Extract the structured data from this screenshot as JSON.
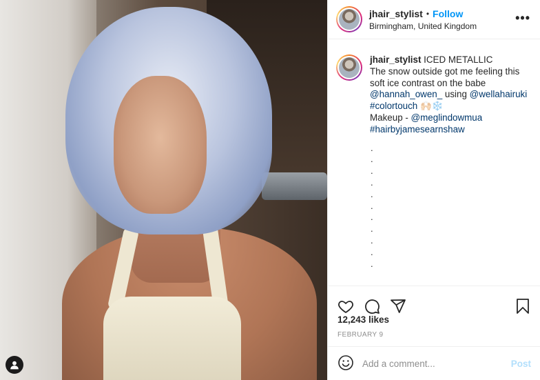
{
  "post": {
    "author": "jhair_stylist",
    "follow_separator": "•",
    "follow_label": "Follow",
    "location": "Birmingham, United Kingdom",
    "more_label": "•••"
  },
  "caption": {
    "author": "jhair_stylist",
    "line1_text": " ICED METALLIC",
    "line2": "The snow outside got me feeling this soft ice contrast on the babe",
    "mention_hannah": "@hannah_owen_",
    "using_text": " using ",
    "mention_wella": "@wellahairuki",
    "hashtag_colortouch": "#colortouch",
    "emoji": "🙌🏻❄️",
    "makeup_text": "Makeup - ",
    "mention_meg": "@meglindowmua",
    "hashtag_james": "#hairbyjamesearnshaw",
    "dots": [
      ".",
      ".",
      ".",
      ".",
      ".",
      ".",
      ".",
      ".",
      ".",
      ".",
      ".",
      "."
    ]
  },
  "actions": {
    "icons": [
      "heart-icon",
      "comment-icon",
      "share-icon",
      "bookmark-icon"
    ]
  },
  "likes": "12,243 likes",
  "date": "FEBRUARY 9",
  "comment": {
    "placeholder": "Add a comment...",
    "post_label": "Post"
  },
  "colors": {
    "link": "#00376b",
    "follow": "#0095f6",
    "post_disabled": "#b2dffc"
  }
}
